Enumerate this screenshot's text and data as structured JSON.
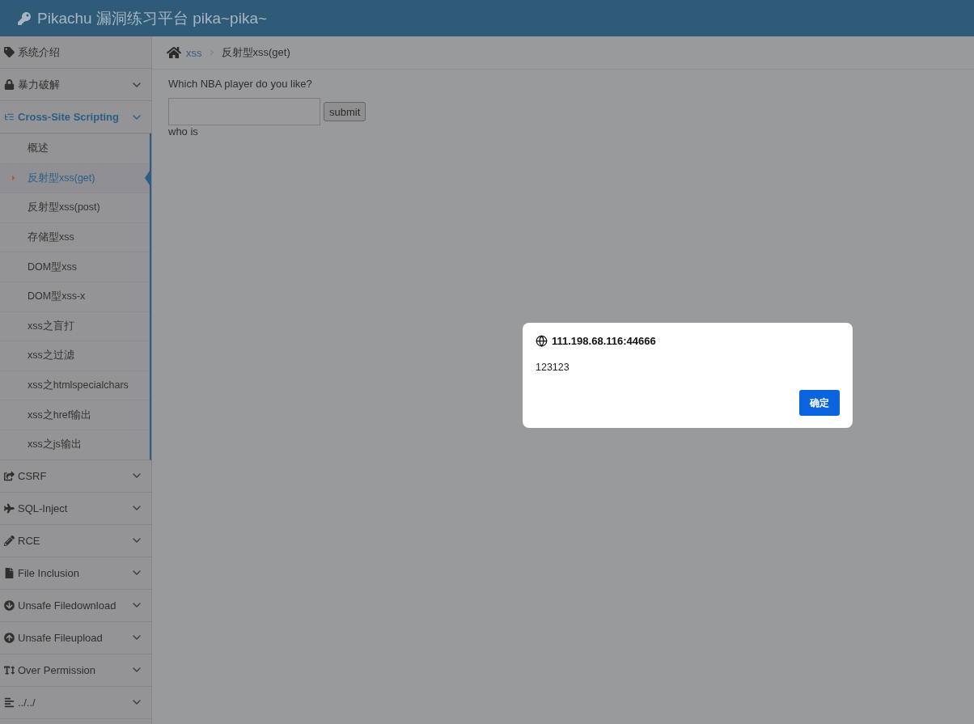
{
  "header": {
    "title": "Pikachu 漏洞练习平台 pika~pika~"
  },
  "sidebar": {
    "items": [
      {
        "kind": "link",
        "label": "系统介绍",
        "expanded": false
      },
      {
        "kind": "menu",
        "label": "暴力破解",
        "expanded": false
      },
      {
        "kind": "menu",
        "label": "Cross-Site Scripting",
        "expanded": true,
        "children": [
          {
            "label": "概述",
            "selected": false
          },
          {
            "label": "反射型xss(get)",
            "selected": true
          },
          {
            "label": "反射型xss(post)",
            "selected": false
          },
          {
            "label": "存储型xss",
            "selected": false
          },
          {
            "label": "DOM型xss",
            "selected": false
          },
          {
            "label": "DOM型xss-x",
            "selected": false
          },
          {
            "label": "xss之盲打",
            "selected": false
          },
          {
            "label": "xss之过滤",
            "selected": false
          },
          {
            "label": "xss之htmlspecialchars",
            "selected": false
          },
          {
            "label": "xss之href输出",
            "selected": false
          },
          {
            "label": "xss之js输出",
            "selected": false
          }
        ]
      },
      {
        "kind": "menu",
        "label": "CSRF",
        "expanded": false
      },
      {
        "kind": "menu",
        "label": "SQL-Inject",
        "expanded": false
      },
      {
        "kind": "menu",
        "label": "RCE",
        "expanded": false
      },
      {
        "kind": "menu",
        "label": "File Inclusion",
        "expanded": false
      },
      {
        "kind": "menu",
        "label": "Unsafe Filedownload",
        "expanded": false
      },
      {
        "kind": "menu",
        "label": "Unsafe Fileupload",
        "expanded": false
      },
      {
        "kind": "menu",
        "label": "Over Permission",
        "expanded": false
      },
      {
        "kind": "menu",
        "label": "../../",
        "expanded": false
      }
    ]
  },
  "breadcrumb": [
    "xss",
    "反射型xss(get)"
  ],
  "form": {
    "question": "Which NBA player do you like?",
    "button": "submit",
    "result": "who is"
  },
  "dialog": {
    "origin": "111.198.68.116:44666",
    "message": "123123",
    "button": "确定"
  }
}
